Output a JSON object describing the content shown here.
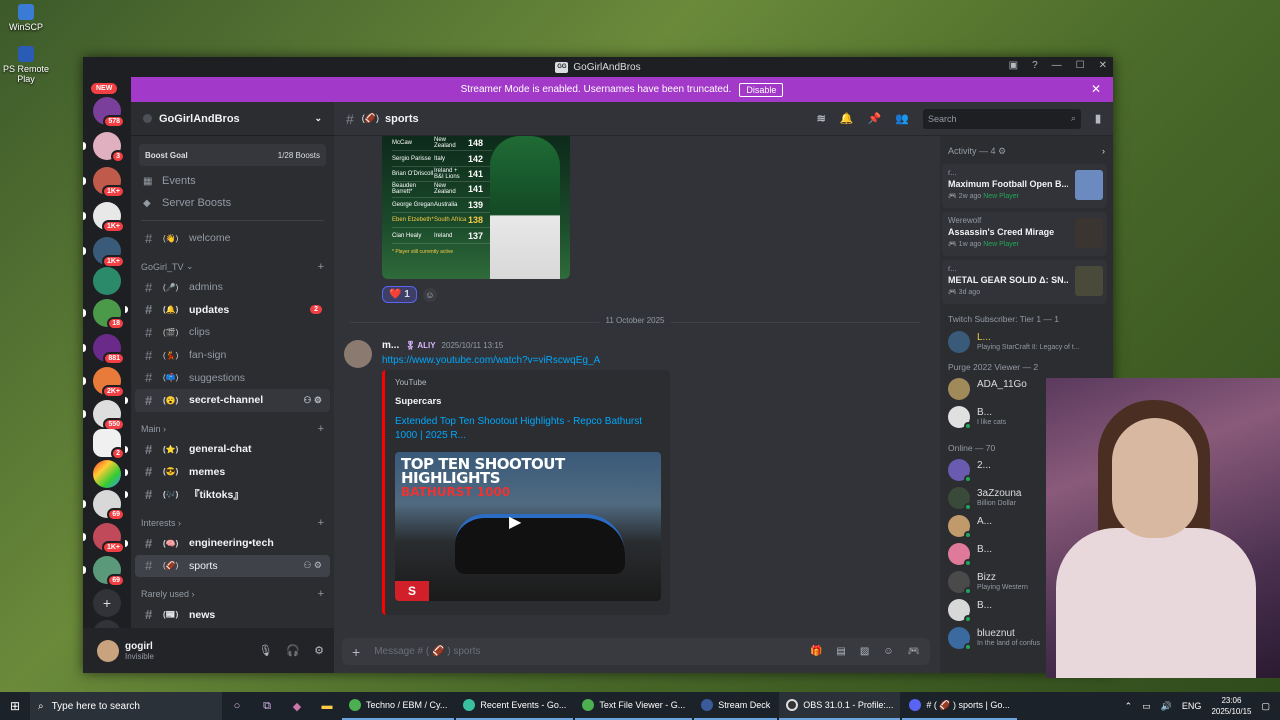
{
  "desktop": {
    "icons": [
      {
        "label": "WinSCP"
      },
      {
        "label": "PS Remote Play"
      }
    ]
  },
  "window": {
    "title": "GoGirlAndBros"
  },
  "banner": {
    "text": "Streamer Mode is enabled. Usernames have been truncated.",
    "button": "Disable"
  },
  "guilds": {
    "new_label": "NEW",
    "badges": [
      "578",
      "3",
      "1K+",
      "1K+",
      "1K+",
      "",
      "18",
      "881",
      "2K+",
      "550",
      "2",
      "",
      "69",
      "1K+",
      "69"
    ]
  },
  "server": {
    "name": "GoGirlAndBros",
    "boost_goal": "Boost Goal",
    "boost_count": "1/28 Boosts",
    "events": "Events",
    "server_boosts": "Server Boosts"
  },
  "channels": {
    "welcome": {
      "emoji": "(👋)",
      "name": "welcome"
    },
    "cat1": "GoGirl_TV",
    "admins": {
      "emoji": "(🎤)",
      "name": "admins"
    },
    "updates": {
      "emoji": "(🔔)",
      "name": "updates",
      "badge": "2"
    },
    "clips": {
      "emoji": "(🎬)",
      "name": "clips"
    },
    "fansign": {
      "emoji": "(💃)",
      "name": "fan-sign"
    },
    "suggestions": {
      "emoji": "(📫)",
      "name": "suggestions"
    },
    "secret": {
      "emoji": "(😮)",
      "name": "secret-channel"
    },
    "cat2": "Main",
    "general": {
      "emoji": "(⭐)",
      "name": "general-chat"
    },
    "memes": {
      "emoji": "(😎)",
      "name": "memes"
    },
    "tiktoks": {
      "emoji": "(🎶)",
      "name": "『tiktoks』"
    },
    "cat3": "Interests",
    "eng": {
      "emoji": "(🧠)",
      "name": "engineering•tech"
    },
    "sports": {
      "emoji": "(🏈)",
      "name": "sports"
    },
    "cat4": "Rarely used",
    "news": {
      "emoji": "(📰)",
      "name": "news"
    }
  },
  "user": {
    "name": "gogirl",
    "status": "Invisible"
  },
  "channel_header": {
    "emoji": "(🏈)",
    "name": "sports",
    "search_placeholder": "Search"
  },
  "chat": {
    "table": [
      {
        "name": "McCaw",
        "country": "New Zealand",
        "value": "148"
      },
      {
        "name": "Sergio Parisse",
        "country": "Italy",
        "value": "142"
      },
      {
        "name": "Brian O'Driscoll",
        "country": "Ireland + B&I Lions",
        "value": "141"
      },
      {
        "name": "Beauden Barrett*",
        "country": "New Zealand",
        "value": "141"
      },
      {
        "name": "George Gregan",
        "country": "Australia",
        "value": "139"
      },
      {
        "name": "Eben Etzebeth*",
        "country": "South Africa",
        "value": "138"
      },
      {
        "name": "Cian Healy",
        "country": "Ireland",
        "value": "137"
      }
    ],
    "table_note": "* Player still currently active",
    "reaction": {
      "emoji": "❤️",
      "count": "1"
    },
    "date_divider": "11 October 2025",
    "message": {
      "author": "m...",
      "tag": "🎖 ALIY",
      "timestamp": "2025/10/11 13:15",
      "link": "https://www.youtube.com/watch?v=viRscwqEg_A"
    },
    "embed": {
      "provider": "YouTube",
      "author": "Supercars",
      "title": "Extended Top Ten Shootout Highlights - Repco Bathurst 1000 | 2025 R...",
      "thumb_line1": "TOP TEN SHOOTOUT",
      "thumb_line2": "HIGHLIGHTS",
      "thumb_line3": "BATHURST 1000",
      "thumb_logo": "S"
    }
  },
  "composer": {
    "placeholder": "Message # ( 🏈 ) sports"
  },
  "members": {
    "activity_header": "Activity — 4",
    "activities": [
      {
        "user": "r...",
        "game": "Maximum Football Open B...",
        "time": "2w ago",
        "note": "New Player"
      },
      {
        "user": "Werewolf",
        "game": "Assassin's Creed Mirage",
        "time": "1w ago",
        "note": "New Player"
      },
      {
        "user": "r...",
        "game": "METAL GEAR SOLID Δ: SN...",
        "time": "3d ago",
        "note": ""
      }
    ],
    "sec1": "Twitch Subscriber: Tier 1 — 1",
    "m1": {
      "name": "L...",
      "status": "Playing StarCraft II: Legacy of t..."
    },
    "sec2": "Purge 2022 Viewer — 2",
    "m2": {
      "name": "ADA_11Go",
      "status": ""
    },
    "m3": {
      "name": "B...",
      "status": "I like cats"
    },
    "sec3": "Online — 70",
    "m4": {
      "name": "2...",
      "status": ""
    },
    "m5": {
      "name": "3aZzouna",
      "status": "Billion Dollar"
    },
    "m6": {
      "name": "A...",
      "status": ""
    },
    "m7": {
      "name": "B...",
      "status": ""
    },
    "m8": {
      "name": "Bizz",
      "status": "Playing Western"
    },
    "m9": {
      "name": "B...",
      "status": ""
    },
    "m10": {
      "name": "blueznut",
      "status": "In the land of confus"
    }
  },
  "taskbar": {
    "search": "Type here to search",
    "tasks": [
      "Techno / EBM / Cy...",
      "Recent Events - Go...",
      "Text File Viewer - G...",
      "Stream Deck",
      "OBS 31.0.1 - Profile:...",
      "# ( 🏈 ) sports | Go..."
    ],
    "lang": "ENG",
    "time": "23:06",
    "date": "2025/10/15"
  }
}
